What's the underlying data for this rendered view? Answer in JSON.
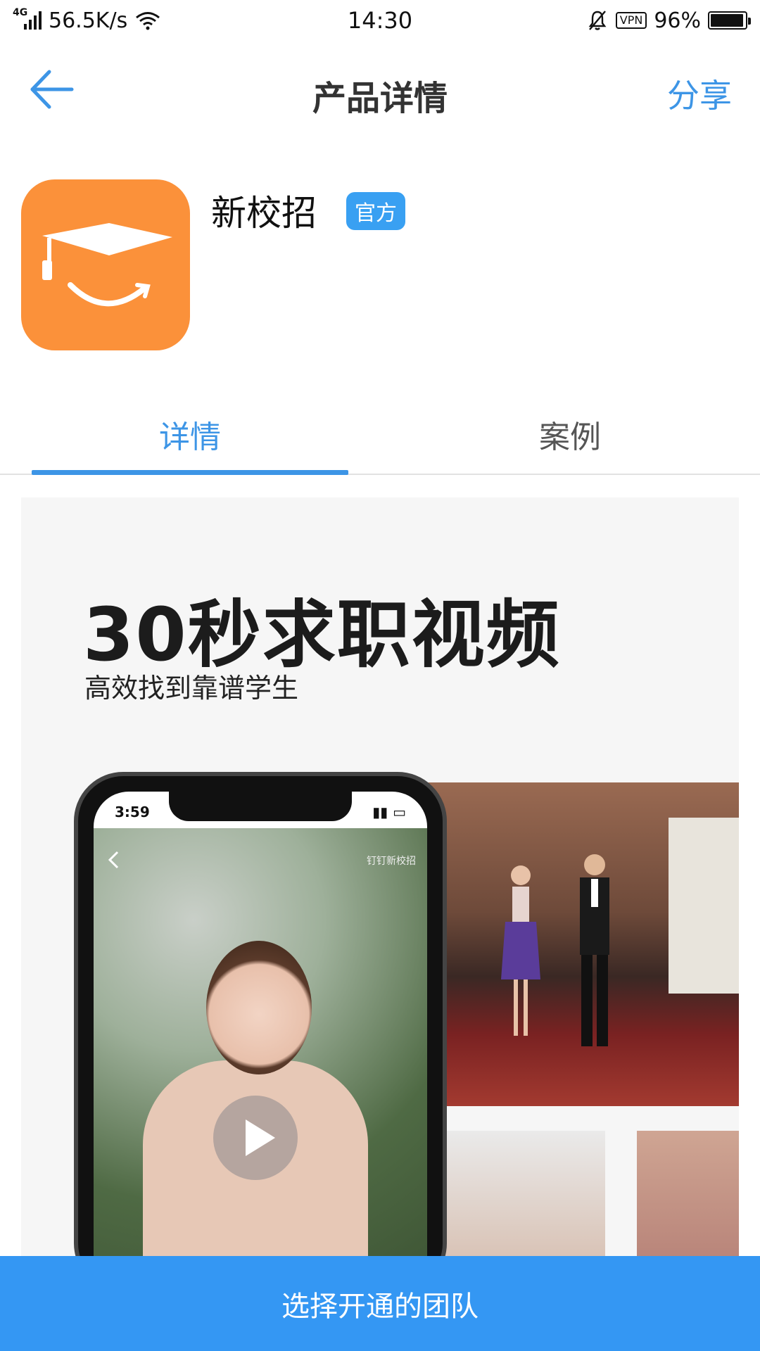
{
  "status_bar": {
    "network_type": "4G",
    "speed": "56.5K/s",
    "time": "14:30",
    "vpn": "VPN",
    "battery": "96%",
    "battery_level": 0.96
  },
  "nav": {
    "title": "产品详情",
    "share_label": "分享"
  },
  "app": {
    "name": "新校招",
    "badge": "官方",
    "icon_color": "#fb913a"
  },
  "tabs": [
    {
      "label": "详情",
      "active": true
    },
    {
      "label": "案例",
      "active": false
    }
  ],
  "banner": {
    "headline": "30秒求职视频",
    "subtitle": "高效找到靠谱学生",
    "phone_time": "3:59",
    "phone_brand": "钉钉新校招"
  },
  "bottom_button": {
    "label": "选择开通的团队"
  },
  "colors": {
    "accent": "#3d95e6",
    "bottom_button": "#3497f3",
    "badge": "#39a0f2"
  }
}
